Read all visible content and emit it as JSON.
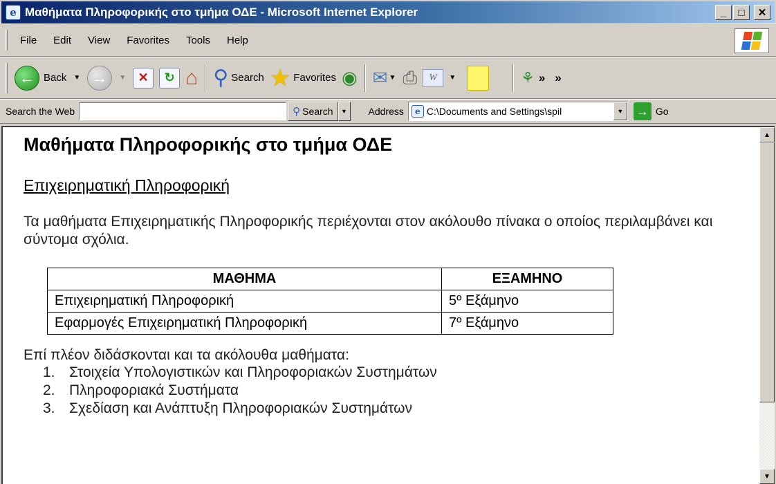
{
  "window": {
    "title": "Μαθήματα Πληροφορικής στο τμήμα ΟΔΕ - Microsoft Internet Explorer",
    "minimize_glyph": "_",
    "maximize_glyph": "□",
    "close_glyph": "✕"
  },
  "menu": {
    "items": [
      {
        "label": "File"
      },
      {
        "label": "Edit"
      },
      {
        "label": "View"
      },
      {
        "label": "Favorites"
      },
      {
        "label": "Tools"
      },
      {
        "label": "Help"
      }
    ]
  },
  "toolbar": {
    "back_label": "Back",
    "search_label": "Search",
    "favorites_label": "Favorites",
    "more_glyph": "»",
    "word_glyph": "W"
  },
  "addressbar": {
    "search_web_label": "Search the Web",
    "search_web_value": "",
    "search_button_label": "Search",
    "address_label": "Address",
    "address_value": "C:\\Documents and Settings\\spil",
    "go_label": "Go"
  },
  "page": {
    "heading": "Μαθήματα Πληροφορικής στο τμήμα ΟΔΕ",
    "subheading": "Επιχειρηματική Πληροφορική",
    "intro": "Τα μαθήματα Επιχειρηματικής Πληροφορικής περιέχονται στον ακόλουθο πίνακα ο οποίος περιλαμβάνει και σύντομα σχόλια.",
    "table": {
      "headers": [
        "ΜΑΘΗΜΑ",
        "ΕΞΑΜΗΝΟ"
      ],
      "rows": [
        [
          "Επιχειρηματική Πληροφορική",
          "5º Εξάμηνο"
        ],
        [
          "Εφαρμογές Επιχειρηματική Πληροφορική",
          "7º Εξάμηνο"
        ]
      ]
    },
    "more_intro": "Επί πλέον διδάσκονται και τα ακόλουθα μαθήματα:",
    "list": [
      {
        "num": "1.",
        "text": "Στοιχεία Υπολογιστικών και Πληροφοριακών Συστημάτων"
      },
      {
        "num": "2.",
        "text": "Πληροφοριακά Συστήματα"
      },
      {
        "num": "3.",
        "text": "Σχεδίαση και Ανάπτυξη Πληροφοριακών Συστημάτων"
      }
    ]
  },
  "colors": {
    "title_bar_start": "#0a246a",
    "title_bar_end": "#a6caf0",
    "chrome": "#d4d0c8"
  }
}
